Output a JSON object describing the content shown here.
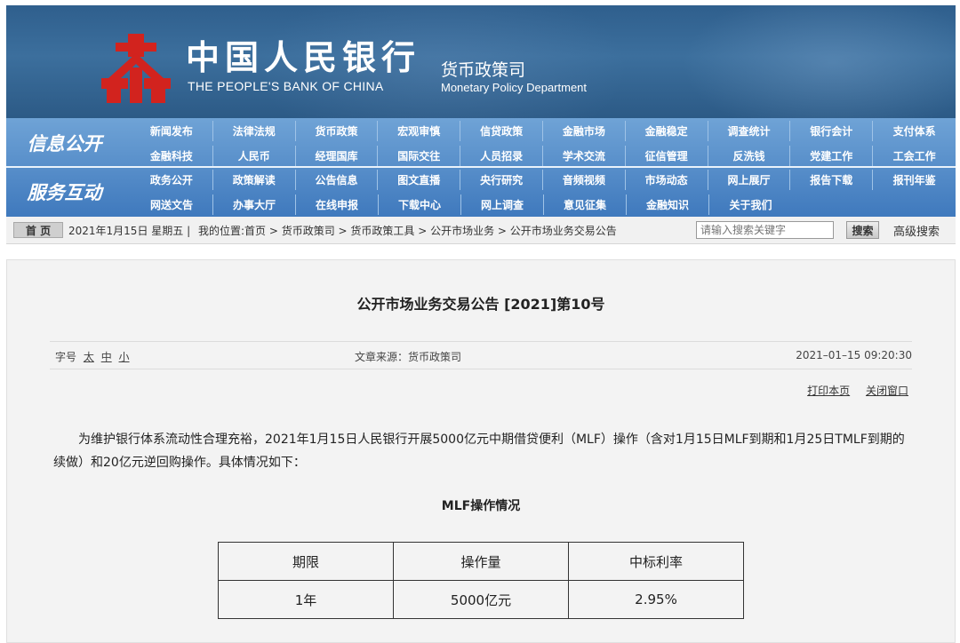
{
  "banner": {
    "cn_name": "中国人民银行",
    "en_name": "THE PEOPLE'S BANK OF CHINA",
    "dept_cn": "货币政策司",
    "dept_en": "Monetary Policy Department"
  },
  "nav": {
    "section1": "信息公开",
    "section2": "服务互动",
    "rows": [
      [
        "新闻发布",
        "法律法规",
        "货币政策",
        "宏观审慎",
        "信贷政策",
        "金融市场",
        "金融稳定",
        "调查统计",
        "银行会计",
        "支付体系"
      ],
      [
        "金融科技",
        "人民币",
        "经理国库",
        "国际交往",
        "人员招录",
        "学术交流",
        "征信管理",
        "反洗钱",
        "党建工作",
        "工会工作"
      ],
      [
        "政务公开",
        "政策解读",
        "公告信息",
        "图文直播",
        "央行研究",
        "音频视频",
        "市场动态",
        "网上展厅",
        "报告下载",
        "报刊年鉴"
      ],
      [
        "网送文告",
        "办事大厅",
        "在线申报",
        "下载中心",
        "网上调查",
        "意见征集",
        "金融知识",
        "关于我们"
      ]
    ]
  },
  "crumb": {
    "home": "首 页",
    "date": "2021年1月15日 星期五 |",
    "path": "我的位置:首页 > 货币政策司 > 货币政策工具 > 公开市场业务 > 公开市场业务交易公告",
    "search_placeholder": "请输入搜索关键字",
    "search_button": "搜索",
    "advanced": "高级搜索"
  },
  "article": {
    "title": "公开市场业务交易公告 [2021]第10号",
    "font_size_label": "字号",
    "font_sizes": [
      "太",
      "中",
      "小"
    ],
    "source": "文章来源：货币政策司",
    "time": "2021–01–15 09:20:30",
    "print": "打印本页",
    "close": "关闭窗口",
    "paragraph": "为维护银行体系流动性合理充裕，2021年1月15日人民银行开展5000亿元中期借贷便利（MLF）操作（含对1月15日MLF到期和1月25日TMLF到期的续做）和20亿元逆回购操作。具体情况如下：",
    "subtitle": "MLF操作情况",
    "table": {
      "headers": [
        "期限",
        "操作量",
        "中标利率"
      ],
      "row": [
        "1年",
        "5000亿元",
        "2.95%"
      ]
    }
  },
  "colors": {
    "banner": "#3c6f9d",
    "nav": "#4f86c6",
    "logo_red": "#d2231e"
  }
}
